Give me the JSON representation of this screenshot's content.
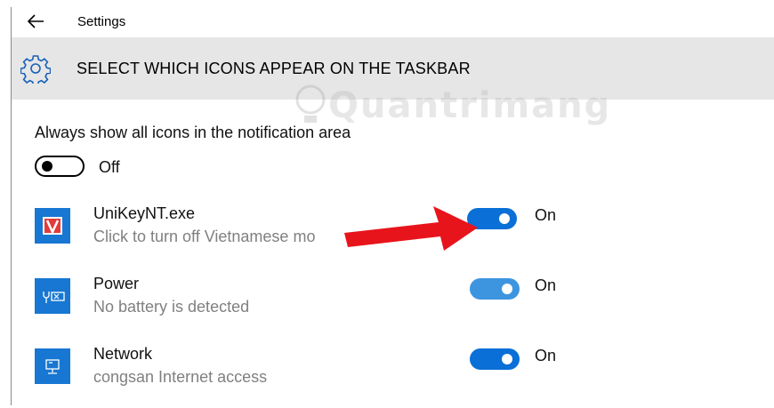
{
  "window": {
    "title": "Settings"
  },
  "header": {
    "title": "SELECT WHICH ICONS APPEAR ON THE TASKBAR"
  },
  "watermark": {
    "text": "Quantrimang"
  },
  "always_show": {
    "label": "Always show all icons in the notification area",
    "state": "Off"
  },
  "apps": [
    {
      "name": "UniKeyNT.exe",
      "description": "Click to turn off Vietnamese mo",
      "state": "On",
      "icon": "unikey-icon"
    },
    {
      "name": "Power",
      "description": "No battery is detected",
      "state": "On",
      "icon": "battery-icon"
    },
    {
      "name": "Network",
      "description": "congsan Internet access",
      "state": "On",
      "icon": "network-icon"
    }
  ],
  "colors": {
    "header_bg": "#e6e6e6",
    "accent": "#0a6fd6",
    "accent_light": "#3d95e0",
    "app_tile": "#1777d2",
    "arrow": "#e8141b"
  }
}
